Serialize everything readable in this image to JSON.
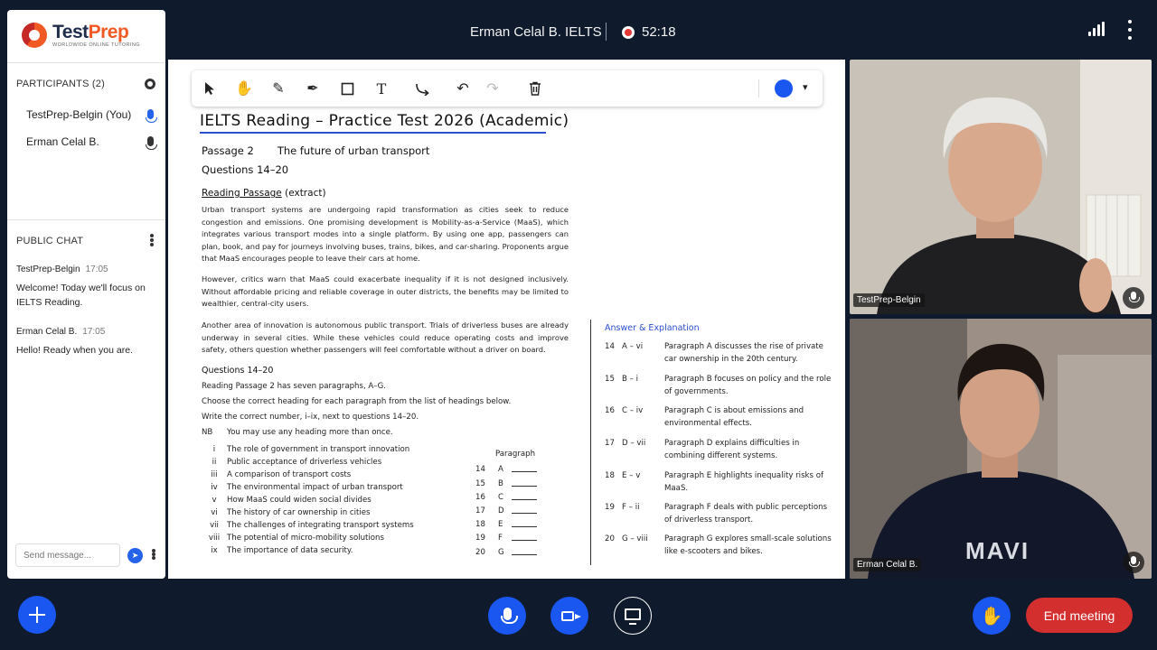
{
  "topbar": {
    "meeting_title": "Erman Celal B. IELTS",
    "recording_time": "52:18"
  },
  "brand": {
    "name_test": "Test",
    "name_prep": "Prep",
    "tagline": "WORLDWIDE ONLINE TUTORING",
    "accent": "#f15a24"
  },
  "participants": {
    "header": "PARTICIPANTS (2)",
    "list": [
      {
        "name": "TestPrep-Belgin (You)",
        "mic_color": "#2563eb"
      },
      {
        "name": "Erman Celal B.",
        "mic_color": "#333333"
      }
    ]
  },
  "chat": {
    "header": "PUBLIC CHAT",
    "messages": [
      {
        "author": "TestPrep-Belgin",
        "time": "17:05",
        "text": "Welcome! Today we'll focus on IELTS Reading."
      },
      {
        "author": "Erman Celal B.",
        "time": "17:05",
        "text": "Hello! Ready when you are."
      }
    ],
    "input_placeholder": "Send message..."
  },
  "whiteboard": {
    "tools": [
      "pointer-icon",
      "hand-icon",
      "pencil-icon",
      "marker-icon",
      "rectangle-icon",
      "text-icon",
      "connector-icon",
      "undo-icon",
      "redo-icon",
      "trash-icon"
    ],
    "pen_color": "#1a56f0"
  },
  "document": {
    "title": "IELTS Reading – Practice Test 2026 (Academic)",
    "passage_label": "Passage 2",
    "passage_title": "The future of urban transport",
    "questions_range": "Questions 14–20",
    "reading_label": "Reading Passage",
    "reading_note": "(extract)",
    "paragraphs": [
      "Urban transport systems are undergoing rapid transformation as cities seek to reduce congestion and emissions. One promising development is Mobility-as-a-Service (MaaS), which integrates various transport modes into a single platform. By using one app, passengers can plan, book, and pay for journeys involving buses, trains, bikes, and car-sharing. Proponents argue that MaaS encourages people to leave their cars at home.",
      "However, critics warn that MaaS could exacerbate inequality if it is not designed inclusively. Without affordable pricing and reliable coverage in outer districts, the benefits may be limited to wealthier, central-city users.",
      "Another area of innovation is autonomous public transport. Trials of driverless buses are already underway in several cities. While these vehicles could reduce operating costs and improve safety, others question whether passengers will feel comfortable without a driver on board."
    ],
    "questions_head": "Questions 14–20",
    "instructions": [
      "Reading Passage 2 has seven paragraphs, A–G.",
      "Choose the correct heading for each paragraph from the list of headings below.",
      "Write the correct number, i–ix, next to questions 14–20."
    ],
    "nb_label": "NB",
    "nb_text": "You may use any heading more than once.",
    "headings": [
      {
        "num": "i",
        "text": "The role of government in transport innovation"
      },
      {
        "num": "ii",
        "text": "Public acceptance of driverless vehicles"
      },
      {
        "num": "iii",
        "text": "A comparison of transport costs"
      },
      {
        "num": "iv",
        "text": "The environmental impact of urban transport"
      },
      {
        "num": "v",
        "text": "How MaaS could widen social divides"
      },
      {
        "num": "vi",
        "text": "The history of car ownership in cities"
      },
      {
        "num": "vii",
        "text": "The challenges of integrating transport systems"
      },
      {
        "num": "viii",
        "text": "The potential of micro-mobility solutions"
      },
      {
        "num": "ix",
        "text": "The importance of data security."
      }
    ],
    "paragraph_col_head": "Paragraph",
    "question_rows": [
      {
        "q": "14",
        "p": "A"
      },
      {
        "q": "15",
        "p": "B"
      },
      {
        "q": "16",
        "p": "C"
      },
      {
        "q": "17",
        "p": "D"
      },
      {
        "q": "18",
        "p": "E"
      },
      {
        "q": "19",
        "p": "F"
      },
      {
        "q": "20",
        "p": "G"
      }
    ],
    "answers_head": "Answer & Explanation",
    "answers": [
      {
        "q": "14",
        "key": "A – vi",
        "text": "Paragraph A discusses the rise of private car ownership in the 20th century."
      },
      {
        "q": "15",
        "key": "B – i",
        "text": "Paragraph B focuses on policy and the role of governments."
      },
      {
        "q": "16",
        "key": "C – iv",
        "text": "Paragraph C is about emissions and environmental effects."
      },
      {
        "q": "17",
        "key": "D – vii",
        "text": "Paragraph D explains difficulties in combining different systems."
      },
      {
        "q": "18",
        "key": "E – v",
        "text": "Paragraph E highlights inequality risks of MaaS."
      },
      {
        "q": "19",
        "key": "F – ii",
        "text": "Paragraph F deals with public perceptions of driverless transport."
      },
      {
        "q": "20",
        "key": "G – viii",
        "text": "Paragraph G explores small-scale solutions like e-scooters and bikes."
      }
    ]
  },
  "videos": [
    {
      "name": "TestPrep-Belgin"
    },
    {
      "name": "Erman Celal B.",
      "shirt_text": "MAVI"
    }
  ],
  "controls": {
    "end_label": "End meeting",
    "end_color": "#d32f2f",
    "primary_color": "#1a56f0"
  }
}
